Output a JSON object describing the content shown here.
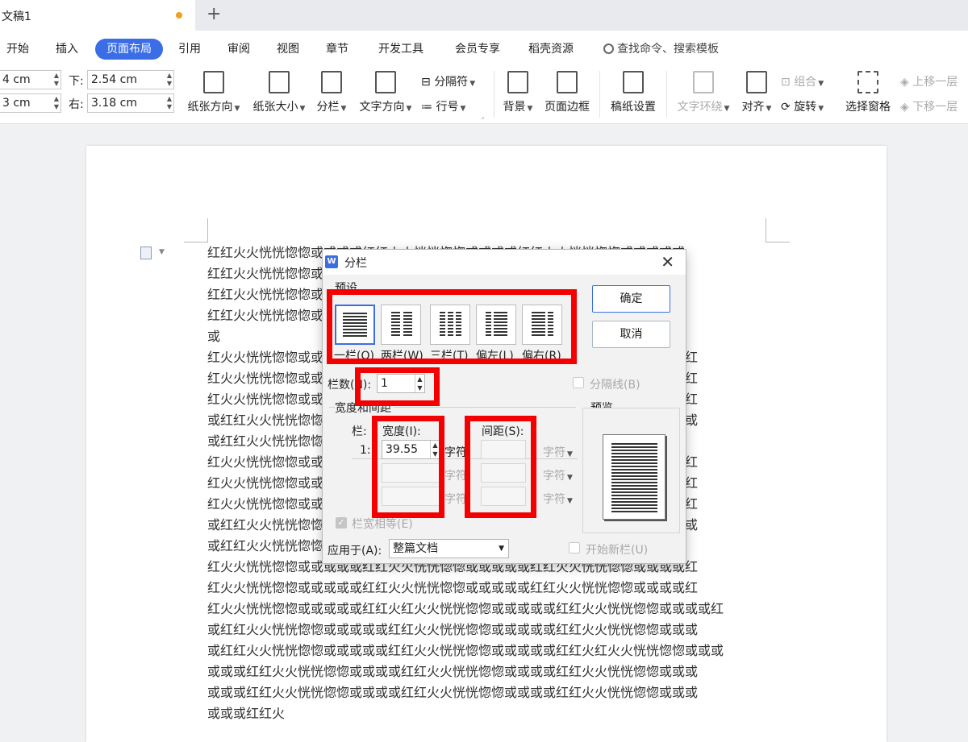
{
  "tabbar": {
    "doc_title": "文稿1",
    "new_tab": "+"
  },
  "menu": {
    "items": [
      "开始",
      "插入",
      "页面布局",
      "引用",
      "审阅",
      "视图",
      "章节",
      "开发工具",
      "会员专享",
      "稻壳资源"
    ],
    "active_index": 2,
    "search_placeholder": "查找命令、搜索模板"
  },
  "ribbon": {
    "margins": {
      "top_value": "4 cm",
      "bottom_label": "下:",
      "bottom_value": "2.54 cm",
      "left_value": "3 cm",
      "right_label": "右:",
      "right_value": "3.18 cm"
    },
    "buttons": {
      "orientation": "纸张方向",
      "size": "纸张大小",
      "columns": "分栏",
      "text_direction": "文字方向",
      "separator": "分隔符",
      "line_number": "行号",
      "background": "背景",
      "page_border": "页面边框",
      "manuscript": "稿纸设置",
      "text_wrap": "文字环绕",
      "align": "对齐",
      "group": "组合",
      "rotate": "旋转",
      "selection_pane": "选择窗格",
      "bring_forward": "上移一层",
      "send_backward": "下移一层"
    }
  },
  "document": {
    "lines": [
      "红红火火恍恍惚惚或或或或红红火火恍恍惚惚或或或或红红火火恍恍惚惚或或或或或",
      "红红火火恍恍惚惚或或或或红红火火恍恍惚惚或或或或红红火火恍恍惚惚或或或或或",
      "红红火火恍恍惚惚或或或或红红火火恍恍惚惚或或或或红红火火恍恍惚惚或或或或或",
      "红红火火恍恍惚惚或或或或红红火火恍恍惚惚或或或或红红火火恍恍惚惚或或或或或",
      "或",
      "红火火恍恍惚惚或或或或或红红火火恍恍惚惚或或或或或红红火火恍恍惚惚或或或或红",
      "红火火恍恍惚惚或或或或或红红火火恍恍惚惚或或或或或红红火火恍恍惚惚或或或或红",
      "红火火恍恍惚惚或或或或或红红火火恍恍惚惚或或或或或红红火火恍恍惚惚或或或或红",
      "或红红火火恍恍惚惚或或或或或红红火火恍恍惚惚或或或或或红红火火恍恍惚惚或或或",
      "或红红火火恍恍惚惚",
      "红火火恍恍惚惚或或或或或红红火火恍恍惚惚或或或或或红红火火恍恍惚惚或或或或红",
      "红火火恍恍惚惚或或或或或红红火火恍恍惚惚或或或或或红红火火恍恍惚惚或或或或红",
      "红火火恍恍惚惚或或或或或红红火火恍恍惚惚或或或或或红红火火恍恍惚惚或或或或红",
      "或红红火火恍恍惚惚或或或或或红红火火恍恍惚惚或或或或或红红火火恍恍惚惚或或或",
      "或红红火火恍恍惚惚",
      "红火火恍恍惚惚或或或或或红红火火恍恍惚惚或或或或或红红火火恍恍惚惚或或或或红",
      "红火火恍恍惚惚或或或或或红红火火恍恍惚惚或或或或或红红火火恍恍惚惚或或或或红",
      "红火火恍恍惚惚或或或或或红红火红火火恍恍惚惚或或或或或红红火火恍恍惚惚或或或或红",
      "或红红火火恍恍惚惚或或或或或红红火火恍恍惚惚或或或或或红红火火恍恍惚惚或或或",
      "或红红火火恍恍惚惚或或或或或红红火火恍恍惚惚或或或或或红红火红火火恍恍惚惚或或或",
      "或或或红红火火恍恍惚惚或或或或红红火火恍恍惚惚或或或或红红火火恍恍惚惚或或或",
      "或或或红红火火恍恍惚惚或或或或红红火火恍恍惚惚或或或或红红火火恍恍惚惚或或或",
      "或或或红红火"
    ]
  },
  "dialog": {
    "logo": "W",
    "title": "分栏",
    "preset_group": "预设",
    "presets": [
      "一栏(O)",
      "两栏(W)",
      "三栏(T)",
      "偏左(L)",
      "偏右(R)"
    ],
    "selected_preset": 0,
    "ok": "确定",
    "cancel": "取消",
    "columns_label": "栏数(N):",
    "columns_value": "1",
    "divider_label": "分隔线(B)",
    "width_spacing_group": "宽度和间距",
    "col_header": "栏:",
    "width_header": "宽度(I):",
    "spacing_header": "间距(S):",
    "rows": [
      {
        "num": "1:",
        "width": "39.55",
        "unit": "字符",
        "spacing": "",
        "spacing_unit": "字符"
      },
      {
        "num": "",
        "width": "",
        "unit": "字符",
        "spacing": "",
        "spacing_unit": "字符"
      },
      {
        "num": "",
        "width": "",
        "unit": "字符",
        "spacing": "",
        "spacing_unit": "字符"
      }
    ],
    "equal_width": "栏宽相等(E)",
    "preview": "预览",
    "apply_label": "应用于(A):",
    "apply_value": "整篇文档",
    "new_column": "开始新栏(U)"
  },
  "colors": {
    "accent": "#3b6ee6",
    "highlight": "#f40000"
  }
}
